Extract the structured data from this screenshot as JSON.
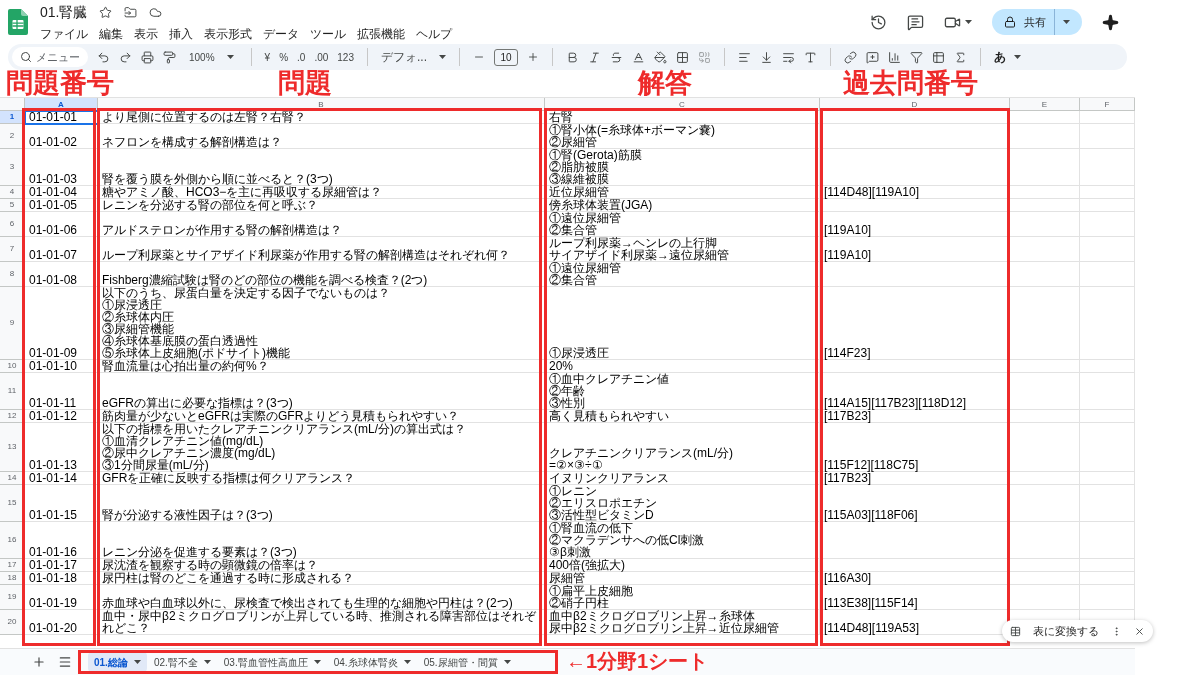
{
  "document": {
    "title": "01.腎臓"
  },
  "menu": [
    "ファイル",
    "編集",
    "表示",
    "挿入",
    "表示形式",
    "データ",
    "ツール",
    "拡張機能",
    "ヘルプ"
  ],
  "share": {
    "label": "共有"
  },
  "toolbar": {
    "search_placeholder": "メニュー",
    "zoom": "100%",
    "currency": "¥",
    "percent": "%",
    "decrease_decimal": ".0",
    "increase_decimal": ".00",
    "number_format": "123",
    "font": "デフォ...",
    "font_size": "10",
    "input_tool": "あ"
  },
  "annotations": {
    "labels": [
      "問題番号",
      "問題",
      "解答",
      "過去問番号"
    ],
    "sheet_note": "←1分野1シート"
  },
  "columns": [
    "A",
    "B",
    "C",
    "D",
    "E",
    "F"
  ],
  "rows": [
    {
      "number": "1",
      "selected": true,
      "cells": [
        [
          "01-01-01"
        ],
        [
          "より尾側に位置するのは左腎？右腎？"
        ],
        [
          "右腎"
        ],
        []
      ]
    },
    {
      "number": "2",
      "selected": false,
      "cells": [
        [
          "01-01-02"
        ],
        [
          "ネフロンを構成する解剖構造は？"
        ],
        [
          "①腎小体(=糸球体+ボーマン嚢)",
          "②尿細管"
        ],
        []
      ]
    },
    {
      "number": "3",
      "selected": false,
      "cells": [
        [
          "01-01-03"
        ],
        [
          "腎を覆う膜を外側から順に並べると？(3つ)"
        ],
        [
          "①腎(Gerota)筋膜",
          "②脂肪被膜",
          "③線維被膜"
        ],
        []
      ]
    },
    {
      "number": "4",
      "selected": false,
      "cells": [
        [
          "01-01-04"
        ],
        [
          "糖やアミノ酸、HCO3−を主に再吸収する尿細管は？"
        ],
        [
          "近位尿細管"
        ],
        [
          "[114D48][119A10]"
        ]
      ]
    },
    {
      "number": "5",
      "selected": false,
      "cells": [
        [
          "01-01-05"
        ],
        [
          "レニンを分泌する腎の部位を何と呼ぶ？"
        ],
        [
          "傍糸球体装置(JGA)"
        ],
        []
      ]
    },
    {
      "number": "6",
      "selected": false,
      "cells": [
        [
          "01-01-06"
        ],
        [
          "アルドステロンが作用する腎の解剖構造は？"
        ],
        [
          "①遠位尿細管",
          "②集合管"
        ],
        [
          "[119A10]"
        ]
      ]
    },
    {
      "number": "7",
      "selected": false,
      "cells": [
        [
          "01-01-07"
        ],
        [
          "ループ利尿薬とサイアザイド利尿薬が作用する腎の解剖構造はそれぞれ何？"
        ],
        [
          "ループ利尿薬→ヘンレの上行脚",
          "サイアザイド利尿薬→遠位尿細管"
        ],
        [
          "[119A10]"
        ]
      ]
    },
    {
      "number": "8",
      "selected": false,
      "cells": [
        [
          "01-01-08"
        ],
        [
          "Fishberg濃縮試験は腎のどの部位の機能を調べる検査？(2つ)"
        ],
        [
          "①遠位尿細管",
          "②集合管"
        ],
        []
      ]
    },
    {
      "number": "9",
      "selected": false,
      "cells": [
        [
          "01-01-09"
        ],
        [
          "以下のうち、尿蛋白量を決定する因子でないものは？",
          "①尿浸透圧",
          "②糸球体内圧",
          "③尿細管機能",
          "④糸球体基底膜の蛋白透過性",
          "⑤糸球体上皮細胞(ポドサイト)機能"
        ],
        [
          "①尿浸透圧"
        ],
        [
          "[114F23]"
        ]
      ]
    },
    {
      "number": "10",
      "selected": false,
      "cells": [
        [
          "01-01-10"
        ],
        [
          "腎血流量は心拍出量の約何%？"
        ],
        [
          "20%"
        ],
        []
      ]
    },
    {
      "number": "11",
      "selected": false,
      "cells": [
        [
          "01-01-11"
        ],
        [
          "eGFRの算出に必要な指標は？(3つ)"
        ],
        [
          "①血中クレアチニン値",
          "②年齢",
          "③性別"
        ],
        [
          "[114A15][117B23][118D12]"
        ]
      ]
    },
    {
      "number": "12",
      "selected": false,
      "cells": [
        [
          "01-01-12"
        ],
        [
          "筋肉量が少ないとeGFRは実際のGFRよりどう見積もられやすい？"
        ],
        [
          "高く見積もられやすい"
        ],
        [
          "[117B23]"
        ]
      ]
    },
    {
      "number": "13",
      "selected": false,
      "cells": [
        [
          "01-01-13"
        ],
        [
          "以下の指標を用いたクレアチニンクリアランス(mL/分)の算出式は？",
          "①血清クレアチニン値(mg/dL)",
          "②尿中クレアチニン濃度(mg/dL)",
          "③1分間尿量(mL/分)"
        ],
        [
          "クレアチニンクリアランス(mL/分)",
          "=②×③÷①"
        ],
        [
          "[115F12][118C75]"
        ]
      ]
    },
    {
      "number": "14",
      "selected": false,
      "cells": [
        [
          "01-01-14"
        ],
        [
          "GFRを正確に反映する指標は何クリアランス？"
        ],
        [
          "イヌリンクリアランス"
        ],
        [
          "[117B23]"
        ]
      ]
    },
    {
      "number": "15",
      "selected": false,
      "cells": [
        [
          "01-01-15"
        ],
        [
          "腎が分泌する液性因子は？(3つ)"
        ],
        [
          "①レニン",
          "②エリスロポエチン",
          "③活性型ビタミンD"
        ],
        [
          "[115A03][118F06]"
        ]
      ]
    },
    {
      "number": "16",
      "selected": false,
      "cells": [
        [
          "01-01-16"
        ],
        [
          "レニン分泌を促進する要素は？(3つ)"
        ],
        [
          "①腎血流の低下",
          "②マクラデンサへの低Cl刺激",
          "③β刺激"
        ],
        []
      ]
    },
    {
      "number": "17",
      "selected": false,
      "cells": [
        [
          "01-01-17"
        ],
        [
          "尿沈渣を観察する時の顕微鏡の倍率は？"
        ],
        [
          "400倍(強拡大)"
        ],
        []
      ]
    },
    {
      "number": "18",
      "selected": false,
      "cells": [
        [
          "01-01-18"
        ],
        [
          "尿円柱は腎のどこを通過する時に形成される？"
        ],
        [
          "尿細管"
        ],
        [
          "[116A30]"
        ]
      ]
    },
    {
      "number": "19",
      "selected": false,
      "cells": [
        [
          "01-01-19"
        ],
        [
          "赤血球や白血球以外に、尿検査で検出されても生理的な細胞や円柱は？(2つ)"
        ],
        [
          "①扁平上皮細胞",
          "②硝子円柱"
        ],
        [
          "[113E38][115F14]"
        ]
      ]
    },
    {
      "number": "20",
      "selected": false,
      "cells": [
        [
          "01-01-20"
        ],
        [
          "血中・尿中β2ミクログロブリンが上昇している時、推測される障害部位はそれぞれどこ？"
        ],
        [
          "血中β2ミクログロブリン上昇→糸球体",
          "尿中β2ミクログロブリン上昇→近位尿細管"
        ],
        [
          "[114D48][119A53]"
        ]
      ]
    }
  ],
  "sheet_tabs": [
    {
      "label": "01.総論",
      "selected": true
    },
    {
      "label": "02.腎不全",
      "selected": false
    },
    {
      "label": "03.腎血管性高血圧",
      "selected": false
    },
    {
      "label": "04.糸球体腎炎",
      "selected": false
    },
    {
      "label": "05.尿細管・間質",
      "selected": false
    }
  ],
  "convert_chip": {
    "label": "表に変換する"
  }
}
